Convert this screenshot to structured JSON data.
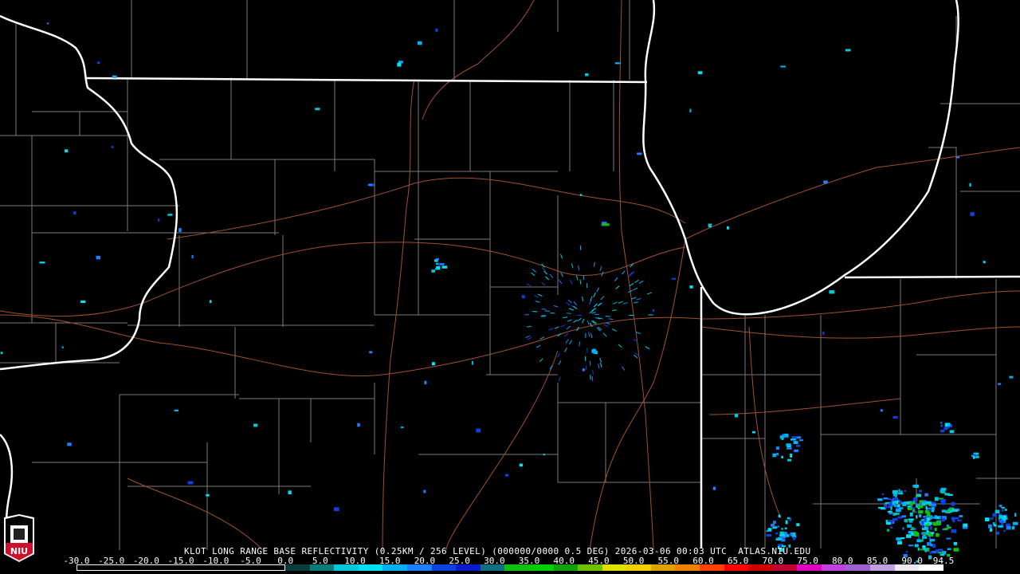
{
  "product": {
    "title": "KLOT LONG RANGE BASE REFLECTIVITY (0.25KM / 256 LEVEL) (000000/0000 0.5 DEG) 2026-03-06 00:03 UTC  ATLAS.NIU.EDU"
  },
  "colorbar": {
    "labels": [
      "-30.0",
      "-25.0",
      "-20.0",
      "-15.0",
      "-10.0",
      "-5.0",
      "0.0",
      "5.0",
      "10.0",
      "15.0",
      "20.0",
      "25.0",
      "30.0",
      "35.0",
      "40.0",
      "45.0",
      "50.0",
      "55.0",
      "60.0",
      "65.0",
      "70.0",
      "75.0",
      "80.0",
      "85.0",
      "90.0",
      "94.5"
    ],
    "min": -30,
    "max": 94.5,
    "colors": [
      "#0a3a3a",
      "#0d7a7a",
      "#00c8d8",
      "#00e0f0",
      "#00b0f0",
      "#1e7fff",
      "#1040e0",
      "#0a1ad0",
      "#107080",
      "#10c010",
      "#00d000",
      "#10a010",
      "#70c000",
      "#e0e000",
      "#f0d000",
      "#e0a000",
      "#f08000",
      "#ff4000",
      "#ff0000",
      "#d00000",
      "#c00030",
      "#e000c0",
      "#c040e0",
      "#a060d0",
      "#c0a0e0",
      "#f0e8f0",
      "#ffffff"
    ]
  },
  "logo": {
    "text": "NIU"
  },
  "colors": {
    "state_border": "#ffffff",
    "county_line": "#808080",
    "road": "#a0522d"
  }
}
